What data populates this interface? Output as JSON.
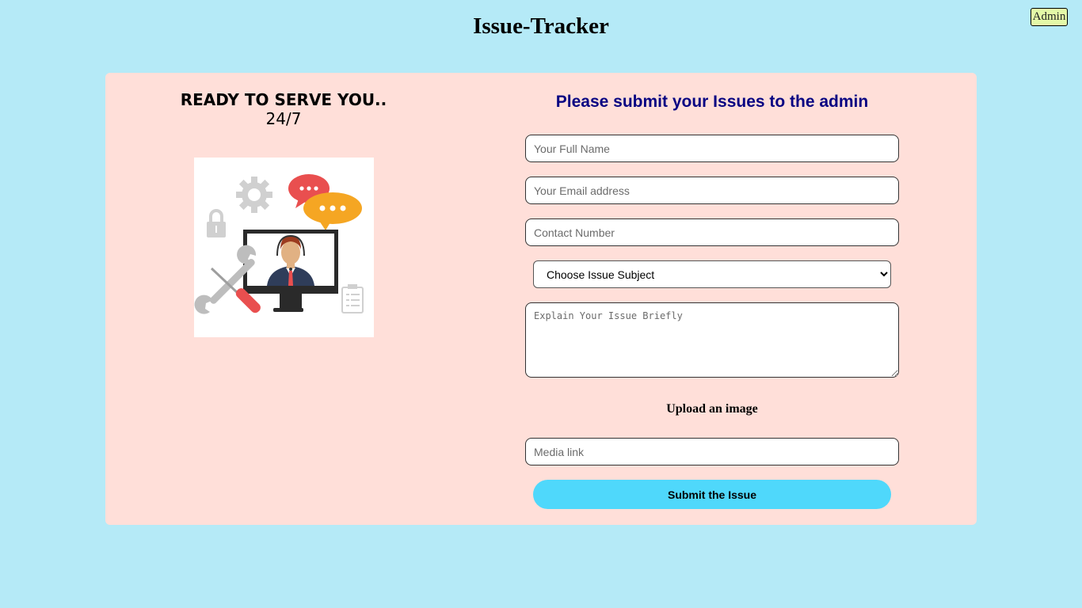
{
  "header": {
    "title": "Issue-Tracker",
    "admin_label": "Admin"
  },
  "left_panel": {
    "heading_line1": "READY TO SERVE YOU..",
    "heading_line2": "24/7"
  },
  "form": {
    "heading": "Please submit your Issues to the admin",
    "full_name_placeholder": "Your Full Name",
    "email_placeholder": "Your Email address",
    "contact_placeholder": "Contact Number",
    "subject_selected": "Choose Issue Subject",
    "issue_placeholder": "Explain Your Issue Briefly",
    "upload_label": "Upload an image",
    "media_placeholder": "Media link",
    "submit_label": "Submit the Issue"
  },
  "colors": {
    "page_background": "#b5eaf7",
    "card_background": "#ffdfd9",
    "heading_color": "#080482",
    "submit_button": "#4fd8fb",
    "admin_button": "#e4f9a8"
  }
}
